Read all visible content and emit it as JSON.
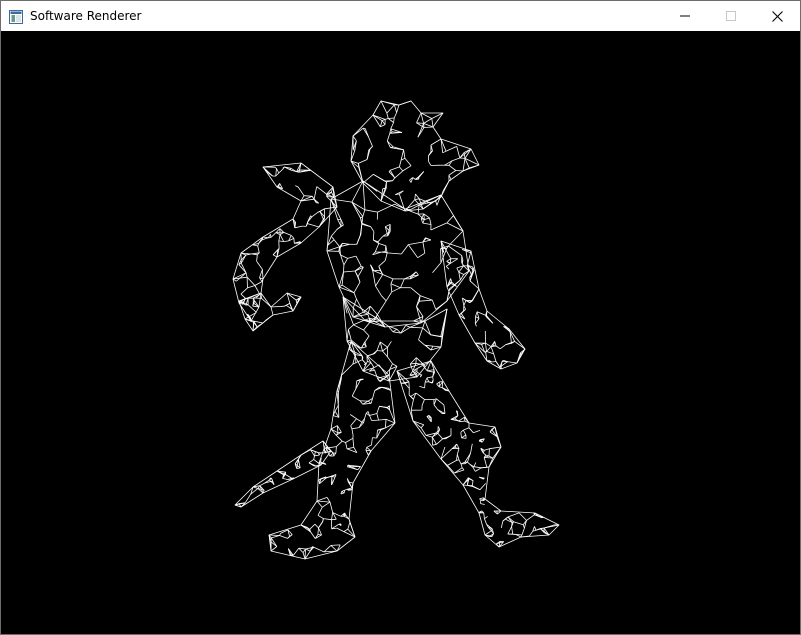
{
  "window": {
    "title": "Software Renderer",
    "background_color": "#000000",
    "wire_color": "#ffffff"
  },
  "titlebar": {
    "app_icon": "window-app-icon",
    "minimize_icon": "minimize-icon",
    "maximize_icon": "maximize-icon",
    "close_icon": "close-icon"
  },
  "viewport": {
    "content": "wireframe-creature-mesh"
  }
}
